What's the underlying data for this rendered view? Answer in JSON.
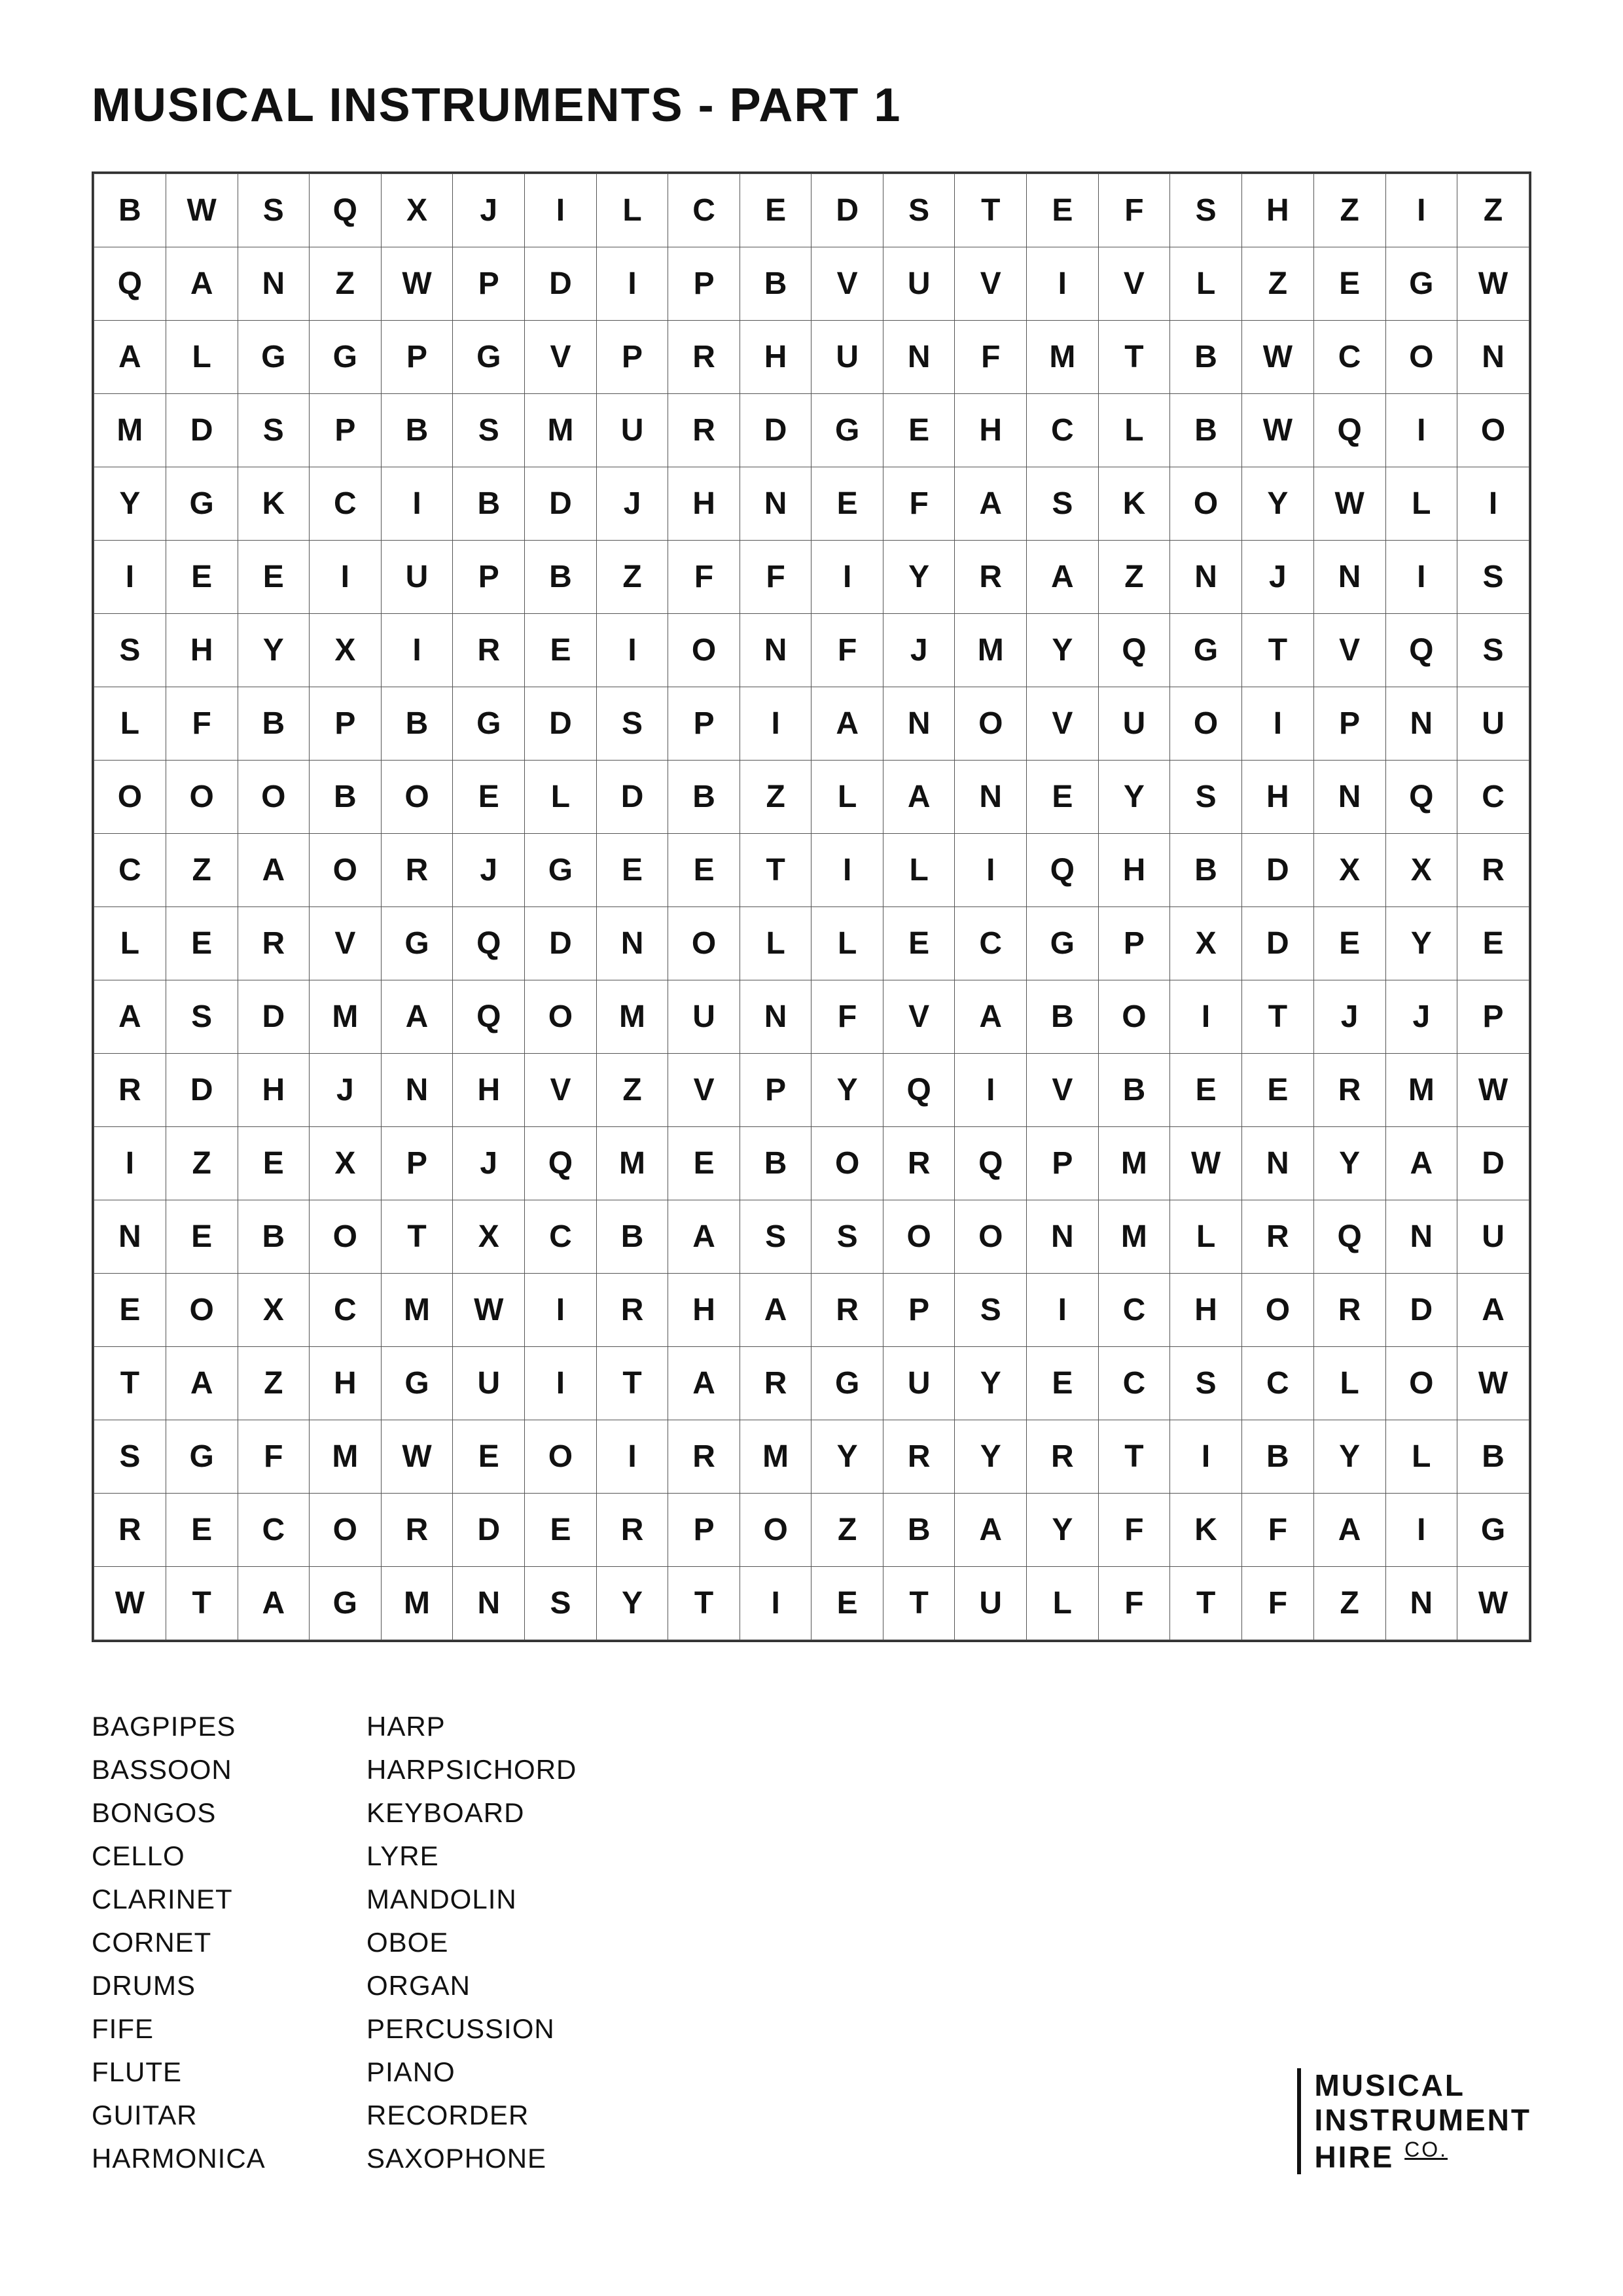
{
  "title": "MUSICAL INSTRUMENTS - PART 1",
  "grid": [
    [
      "B",
      "W",
      "S",
      "Q",
      "X",
      "J",
      "I",
      "L",
      "C",
      "E",
      "D",
      "S",
      "T",
      "E",
      "F",
      "S",
      "H",
      "Z",
      "I",
      "Z"
    ],
    [
      "Q",
      "A",
      "N",
      "Z",
      "W",
      "P",
      "D",
      "I",
      "P",
      "B",
      "V",
      "U",
      "V",
      "I",
      "V",
      "L",
      "Z",
      "E",
      "G",
      "W"
    ],
    [
      "A",
      "L",
      "G",
      "G",
      "P",
      "G",
      "V",
      "P",
      "R",
      "H",
      "U",
      "N",
      "F",
      "M",
      "T",
      "B",
      "W",
      "C",
      "O",
      "N"
    ],
    [
      "M",
      "D",
      "S",
      "P",
      "B",
      "S",
      "M",
      "U",
      "R",
      "D",
      "G",
      "E",
      "H",
      "C",
      "L",
      "B",
      "W",
      "Q",
      "I",
      "O"
    ],
    [
      "Y",
      "G",
      "K",
      "C",
      "I",
      "B",
      "D",
      "J",
      "H",
      "N",
      "E",
      "F",
      "A",
      "S",
      "K",
      "O",
      "Y",
      "W",
      "L",
      "I"
    ],
    [
      "I",
      "E",
      "E",
      "I",
      "U",
      "P",
      "B",
      "Z",
      "F",
      "F",
      "I",
      "Y",
      "R",
      "A",
      "Z",
      "N",
      "J",
      "N",
      "I",
      "S"
    ],
    [
      "S",
      "H",
      "Y",
      "X",
      "I",
      "R",
      "E",
      "I",
      "O",
      "N",
      "F",
      "J",
      "M",
      "Y",
      "Q",
      "G",
      "T",
      "V",
      "Q",
      "S"
    ],
    [
      "L",
      "F",
      "B",
      "P",
      "B",
      "G",
      "D",
      "S",
      "P",
      "I",
      "A",
      "N",
      "O",
      "V",
      "U",
      "O",
      "I",
      "P",
      "N",
      "U"
    ],
    [
      "O",
      "O",
      "O",
      "B",
      "O",
      "E",
      "L",
      "D",
      "B",
      "Z",
      "L",
      "A",
      "N",
      "E",
      "Y",
      "S",
      "H",
      "N",
      "Q",
      "C"
    ],
    [
      "C",
      "Z",
      "A",
      "O",
      "R",
      "J",
      "G",
      "E",
      "E",
      "T",
      "I",
      "L",
      "I",
      "Q",
      "H",
      "B",
      "D",
      "X",
      "X",
      "R"
    ],
    [
      "L",
      "E",
      "R",
      "V",
      "G",
      "Q",
      "D",
      "N",
      "O",
      "L",
      "L",
      "E",
      "C",
      "G",
      "P",
      "X",
      "D",
      "E",
      "Y",
      "E"
    ],
    [
      "A",
      "S",
      "D",
      "M",
      "A",
      "Q",
      "O",
      "M",
      "U",
      "N",
      "F",
      "V",
      "A",
      "B",
      "O",
      "I",
      "T",
      "J",
      "J",
      "P"
    ],
    [
      "R",
      "D",
      "H",
      "J",
      "N",
      "H",
      "V",
      "Z",
      "V",
      "P",
      "Y",
      "Q",
      "I",
      "V",
      "B",
      "E",
      "E",
      "R",
      "M",
      "W"
    ],
    [
      "I",
      "Z",
      "E",
      "X",
      "P",
      "J",
      "Q",
      "M",
      "E",
      "B",
      "O",
      "R",
      "Q",
      "P",
      "M",
      "W",
      "N",
      "Y",
      "A",
      "D"
    ],
    [
      "N",
      "E",
      "B",
      "O",
      "T",
      "X",
      "C",
      "B",
      "A",
      "S",
      "S",
      "O",
      "O",
      "N",
      "M",
      "L",
      "R",
      "Q",
      "N",
      "U"
    ],
    [
      "E",
      "O",
      "X",
      "C",
      "M",
      "W",
      "I",
      "R",
      "H",
      "A",
      "R",
      "P",
      "S",
      "I",
      "C",
      "H",
      "O",
      "R",
      "D",
      "A"
    ],
    [
      "T",
      "A",
      "Z",
      "H",
      "G",
      "U",
      "I",
      "T",
      "A",
      "R",
      "G",
      "U",
      "Y",
      "E",
      "C",
      "S",
      "C",
      "L",
      "O",
      "W"
    ],
    [
      "S",
      "G",
      "F",
      "M",
      "W",
      "E",
      "O",
      "I",
      "R",
      "M",
      "Y",
      "R",
      "Y",
      "R",
      "T",
      "I",
      "B",
      "Y",
      "L",
      "B"
    ],
    [
      "R",
      "E",
      "C",
      "O",
      "R",
      "D",
      "E",
      "R",
      "P",
      "O",
      "Z",
      "B",
      "A",
      "Y",
      "F",
      "K",
      "F",
      "A",
      "I",
      "G"
    ],
    [
      "W",
      "T",
      "A",
      "G",
      "M",
      "N",
      "S",
      "Y",
      "T",
      "I",
      "E",
      "T",
      "U",
      "L",
      "F",
      "T",
      "F",
      "Z",
      "N",
      "W"
    ]
  ],
  "words_col1": [
    "BAGPIPES",
    "BASSOON",
    "BONGOS",
    "CELLO",
    "CLARINET",
    "CORNET",
    "DRUMS",
    "FIFE",
    "FLUTE",
    "GUITAR",
    "HARMONICA"
  ],
  "words_col2": [
    "HARP",
    "HARPSICHORD",
    "KEYBOARD",
    "LYRE",
    "MANDOLIN",
    "OBOE",
    "ORGAN",
    "PERCUSSION",
    "PIANO",
    "RECORDER",
    "SAXOPHONE"
  ],
  "logo": {
    "line1": "MUSICAL",
    "line2": "INSTRUMENT",
    "line3": "HIRE CO."
  }
}
